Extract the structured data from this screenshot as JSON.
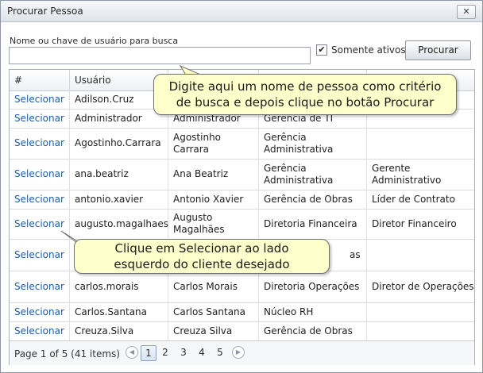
{
  "window": {
    "title": "Procurar Pessoa",
    "close_glyph": "✕"
  },
  "search": {
    "label": "Nome ou chave de usuário para busca",
    "value": "",
    "placeholder": "",
    "only_active_label": "Somente ativos",
    "only_active_checked": true,
    "check_glyph": "✔",
    "button_label": "Procurar"
  },
  "grid": {
    "columns": [
      "#",
      "Usuário",
      "",
      "",
      ""
    ],
    "rows": [
      {
        "action": "Selecionar",
        "user": "Adilson.Cruz",
        "name": "",
        "dept": "",
        "role": ""
      },
      {
        "action": "Selecionar",
        "user": "Administrador",
        "name": "Administrador",
        "dept": "Gerência de TI",
        "role": ""
      },
      {
        "action": "Selecionar",
        "user": "Agostinho.Carrara",
        "name": "Agostinho Carrara",
        "dept": "Gerência Administrativa",
        "role": ""
      },
      {
        "action": "Selecionar",
        "user": "ana.beatriz",
        "name": "Ana Beatriz",
        "dept": "Gerência Administrativa",
        "role": "Gerente Administrativo"
      },
      {
        "action": "Selecionar",
        "user": "antonio.xavier",
        "name": "Antonio Xavier",
        "dept": "Gerência de Obras",
        "role": "Líder de Contrato"
      },
      {
        "action": "Selecionar",
        "user": "augusto.magalhaes",
        "name": "Augusto Magalhães",
        "dept": "Diretoria Financeira",
        "role": "Diretor Financeiro"
      },
      {
        "action": "Selecionar",
        "user": "",
        "name": "",
        "dept": "as",
        "role": ""
      },
      {
        "action": "Selecionar",
        "user": "carlos.morais",
        "name": "Carlos Morais",
        "dept": "Diretoria Operações",
        "role": "Diretor de Operações"
      },
      {
        "action": "Selecionar",
        "user": "Carlos.Santana",
        "name": "Carlos Santana",
        "dept": "Núcleo RH",
        "role": ""
      },
      {
        "action": "Selecionar",
        "user": "Creuza.Silva",
        "name": "Creuza Silva",
        "dept": "Gerência de Obras",
        "role": ""
      }
    ]
  },
  "pager": {
    "info": "Page 1 of 5 (41 items)",
    "prev_glyph": "◀",
    "next_glyph": "▶",
    "pages": [
      "1",
      "2",
      "3",
      "4",
      "5"
    ],
    "current_page": "1"
  },
  "callouts": {
    "search_hint": "Digite aqui um nome de pessoa como critério de busca e depois clique no botão Procurar",
    "select_hint": "Clique em Selecionar ao lado esquerdo do cliente desejado"
  },
  "colors": {
    "link": "#1a5ea8",
    "callout_bg": "#ffffcc",
    "accent_border": "#8aa3c2"
  }
}
